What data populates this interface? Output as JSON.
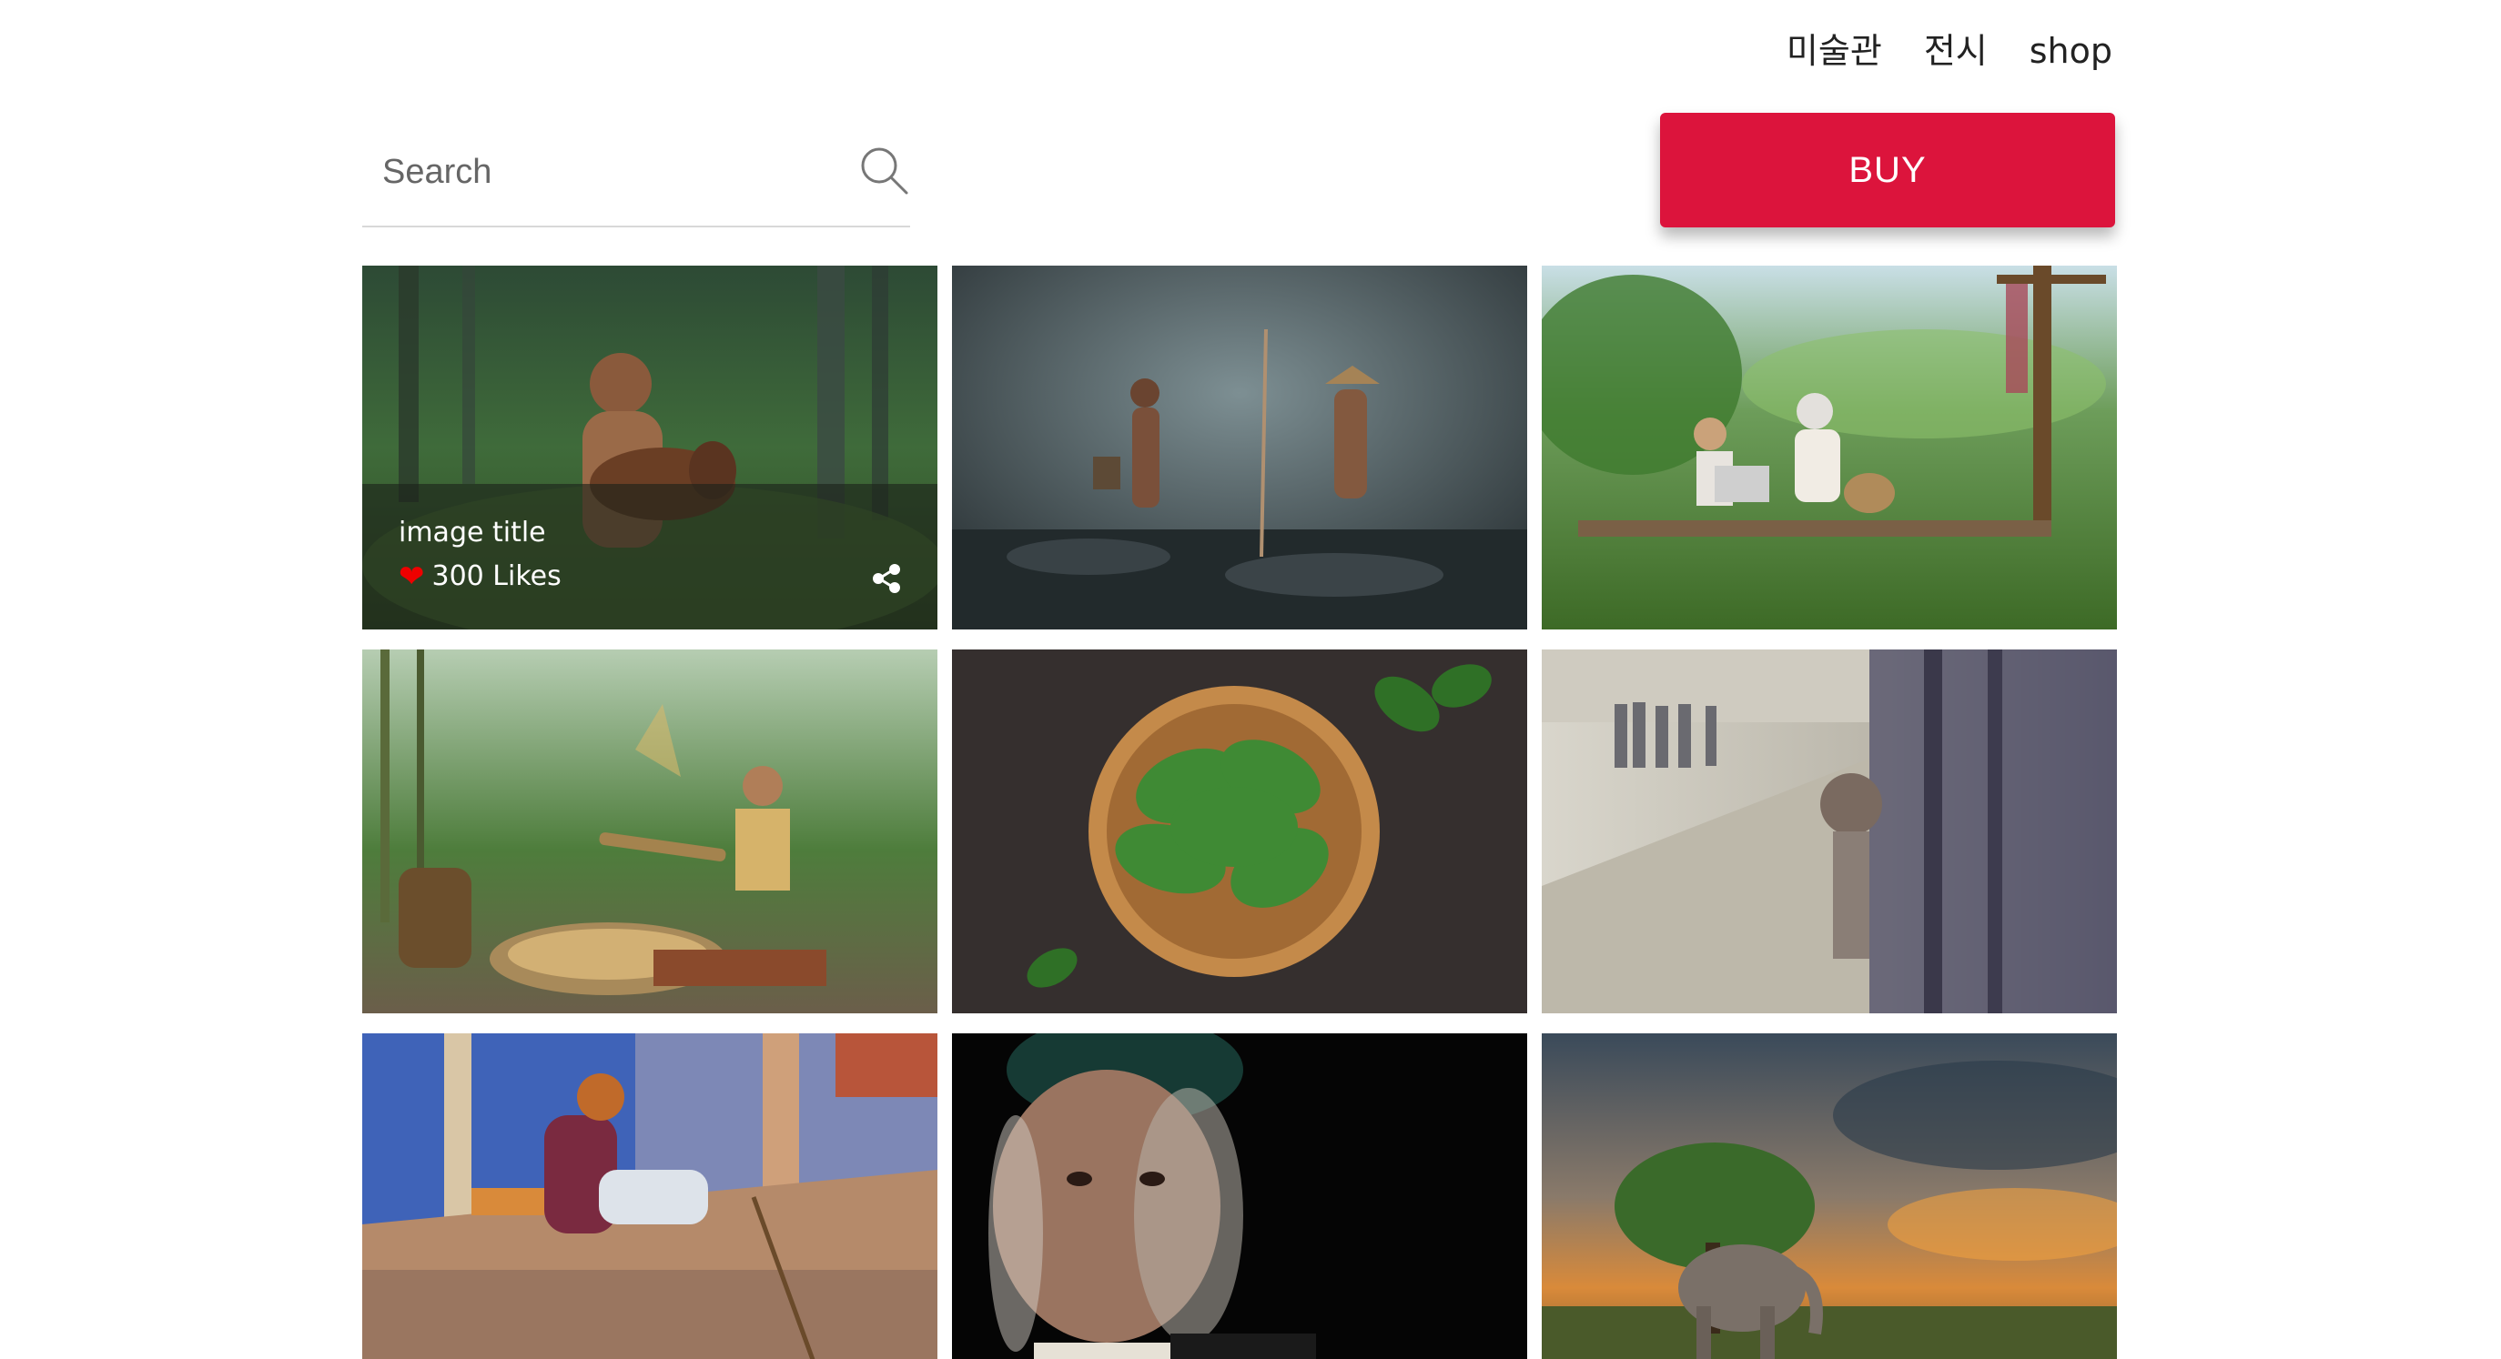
{
  "nav": {
    "items": [
      {
        "label": "미술관"
      },
      {
        "label": "전시"
      },
      {
        "label": "shop"
      }
    ]
  },
  "search": {
    "placeholder": "Search",
    "icon": "search-icon"
  },
  "buy_button": {
    "label": "BUY",
    "color": "#dc143c"
  },
  "gallery": {
    "featured": {
      "title": "image title",
      "likes": "300 Likes",
      "like_icon": "heart-icon",
      "share_icon": "share-icon",
      "like_color": "#e00000"
    }
  }
}
